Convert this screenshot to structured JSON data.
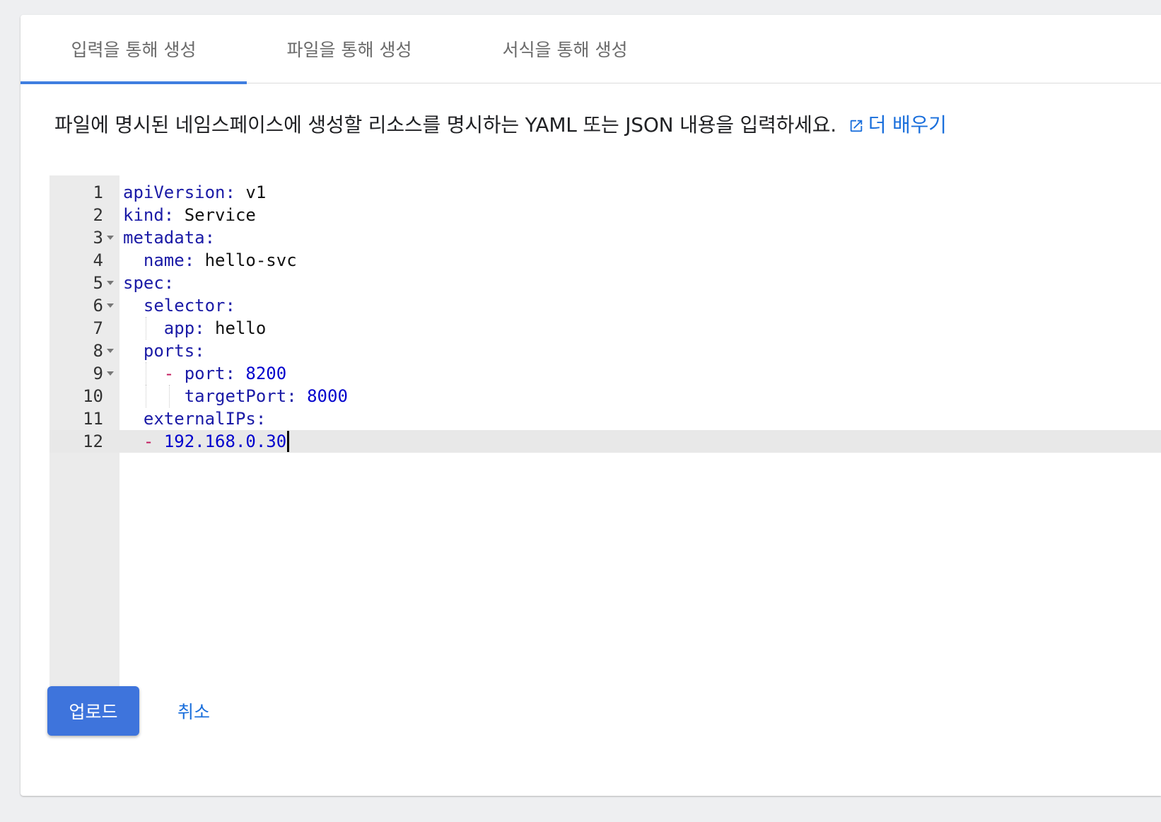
{
  "tabs": [
    {
      "label": "입력을 통해 생성",
      "active": true
    },
    {
      "label": "파일을 통해 생성",
      "active": false
    },
    {
      "label": "서식을 통해 생성",
      "active": false
    }
  ],
  "description": {
    "text": "파일에 명시된 네임스페이스에 생성할 리소스를 명시하는 YAML 또는 JSON 내용을 입력하세요.",
    "link_label": "더 배우기",
    "link_icon": "external-link-icon"
  },
  "editor": {
    "lines": [
      {
        "num": "1",
        "fold": false,
        "key": "apiVersion:",
        "value": "v1",
        "value_type": "str",
        "dash": false,
        "indent": 0
      },
      {
        "num": "2",
        "fold": false,
        "key": "kind:",
        "value": "Service",
        "value_type": "str",
        "dash": false,
        "indent": 0
      },
      {
        "num": "3",
        "fold": true,
        "key": "metadata:",
        "value": "",
        "value_type": "str",
        "dash": false,
        "indent": 0
      },
      {
        "num": "4",
        "fold": false,
        "key": "name:",
        "value": "hello-svc",
        "value_type": "str",
        "dash": false,
        "indent": 1
      },
      {
        "num": "5",
        "fold": true,
        "key": "spec:",
        "value": "",
        "value_type": "str",
        "dash": false,
        "indent": 0
      },
      {
        "num": "6",
        "fold": true,
        "key": "selector:",
        "value": "",
        "value_type": "str",
        "dash": false,
        "indent": 1
      },
      {
        "num": "7",
        "fold": false,
        "key": "app:",
        "value": "hello",
        "value_type": "str",
        "dash": false,
        "indent": 2
      },
      {
        "num": "8",
        "fold": true,
        "key": "ports:",
        "value": "",
        "value_type": "str",
        "dash": false,
        "indent": 1
      },
      {
        "num": "9",
        "fold": true,
        "key": "port:",
        "value": "8200",
        "value_type": "num",
        "dash": true,
        "indent": 2
      },
      {
        "num": "10",
        "fold": false,
        "key": "targetPort:",
        "value": "8000",
        "value_type": "num",
        "dash": false,
        "indent": 3
      },
      {
        "num": "11",
        "fold": false,
        "key": "externalIPs:",
        "value": "",
        "value_type": "str",
        "dash": false,
        "indent": 1
      },
      {
        "num": "12",
        "fold": false,
        "key": "",
        "value": "192.168.0.30",
        "value_type": "num",
        "dash": true,
        "indent": 1,
        "active": true
      }
    ]
  },
  "buttons": {
    "upload": "업로드",
    "cancel": "취소"
  },
  "colors": {
    "accent": "#3e74dc",
    "link": "#1a6fdc",
    "yaml_key": "#1a1aa6",
    "yaml_number": "#0000cd",
    "yaml_dash": "#c2185b"
  }
}
